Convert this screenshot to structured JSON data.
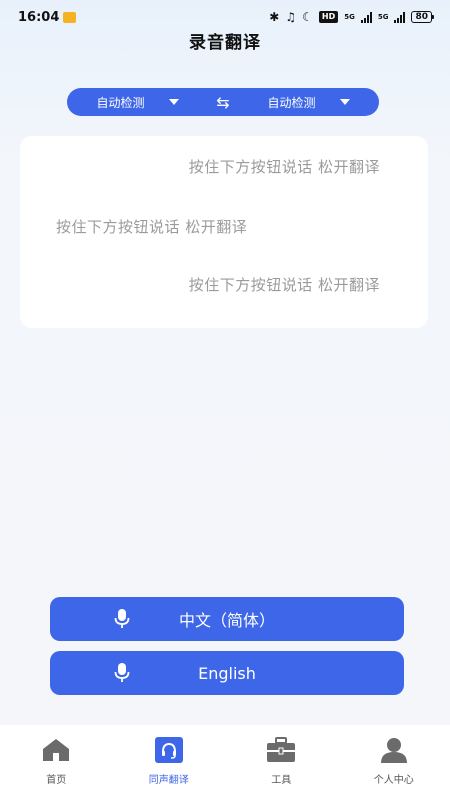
{
  "status_bar": {
    "time": "16:04",
    "hd": "HD",
    "net_a": "5G",
    "net_b": "5G",
    "battery": "80"
  },
  "page_title": "录音翻译",
  "lang_bar": {
    "source": "自动检测",
    "target": "自动检测"
  },
  "transcript": [
    "按住下方按钮说话 松开翻译",
    "按住下方按钮说话 松开翻译",
    "按住下方按钮说话 松开翻译"
  ],
  "record_buttons": {
    "chinese_label": "中文（简体）",
    "english_label": "English"
  },
  "bottom_nav": [
    {
      "label": "首页",
      "icon": "home-icon",
      "active": false
    },
    {
      "label": "同声翻译",
      "icon": "headset-icon",
      "active": true
    },
    {
      "label": "工具",
      "icon": "toolbox-icon",
      "active": false
    },
    {
      "label": "个人中心",
      "icon": "person-icon",
      "active": false
    }
  ],
  "colors": {
    "accent": "#3e66e8",
    "nav_inactive_icon": "#6b6b6b",
    "placeholder_text": "#9b9b9b"
  }
}
